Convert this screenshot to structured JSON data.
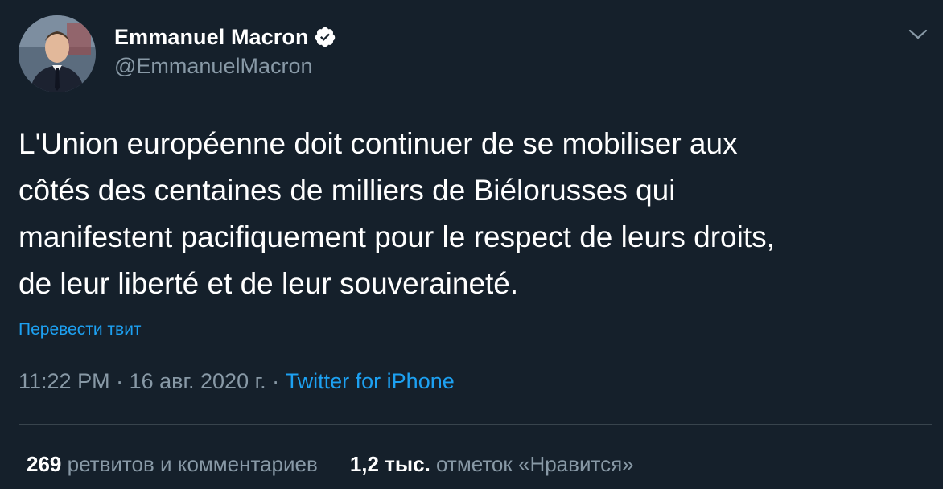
{
  "author": {
    "name": "Emmanuel Macron",
    "handle": "@EmmanuelMacron",
    "verified": true
  },
  "tweet": {
    "text": "L'Union européenne doit continuer de se mobiliser aux\ncôtés des centaines de milliers de Biélorusses qui\nmanifestent pacifiquement pour le respect de leurs droits,\nde leur liberté et de leur souveraineté.",
    "translate_label": "Перевести твит",
    "time": "11:22 PM",
    "sep1": " · ",
    "date": "16 авг. 2020 г.",
    "sep2": " · ",
    "source": "Twitter for iPhone"
  },
  "stats": {
    "retweets_count": "269",
    "retweets_label": "ретвитов и комментариев",
    "likes_count": "1,2 тыс.",
    "likes_label": "отметок «Нравится»"
  },
  "colors": {
    "background": "#15202b",
    "text": "#ffffff",
    "secondary": "#8899a6",
    "accent": "#1da1f2",
    "divider": "#38444d"
  },
  "icons": {
    "verified": "verified-badge-icon",
    "more": "chevron-down-icon"
  }
}
